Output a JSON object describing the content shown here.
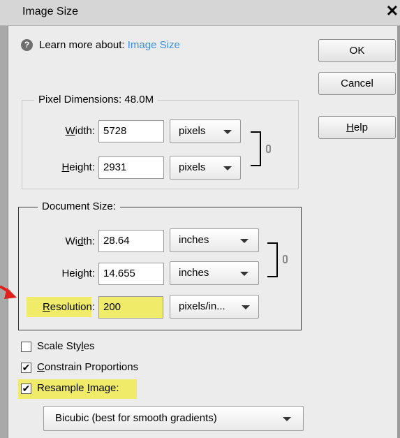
{
  "window": {
    "title": "Image Size",
    "close_glyph": "✕"
  },
  "learn": {
    "prefix": "Learn more about:",
    "link": "Image Size"
  },
  "buttons": {
    "ok": "OK",
    "cancel": "Cancel",
    "help_underlined": "H",
    "help_rest": "elp"
  },
  "pixel_dimensions": {
    "legend": "Pixel Dimensions:  48.0M",
    "width": {
      "u": "W",
      "rest": "idth:",
      "value": "5728",
      "unit": "pixels"
    },
    "height": {
      "u": "H",
      "rest": "eight:",
      "value": "2931",
      "unit": "pixels"
    }
  },
  "document_size": {
    "legend": "Document Size:",
    "width": {
      "pre": "Wi",
      "u": "d",
      "rest": "th:",
      "value": "28.64",
      "unit": "inches"
    },
    "height": {
      "pre": "Hei",
      "u": "g",
      "rest": "ht:",
      "value": "14.655",
      "unit": "inches"
    },
    "resolution": {
      "u": "R",
      "rest": "esolution:",
      "value": "200",
      "unit": "pixels/in..."
    }
  },
  "options": {
    "scale_styles": {
      "pre": "Scale Sty",
      "u": "l",
      "rest": "es",
      "checked": false
    },
    "constrain": {
      "u": "C",
      "rest": "onstrain Proportions",
      "checked": true
    },
    "resample": {
      "pre": "Resample ",
      "u": "I",
      "rest": "mage:",
      "checked": true
    },
    "method": "Bicubic (best for smooth gradients)"
  },
  "colors": {
    "highlight": "#f0ec6a",
    "link": "#3a8ee6",
    "arrow": "#e0201c"
  }
}
